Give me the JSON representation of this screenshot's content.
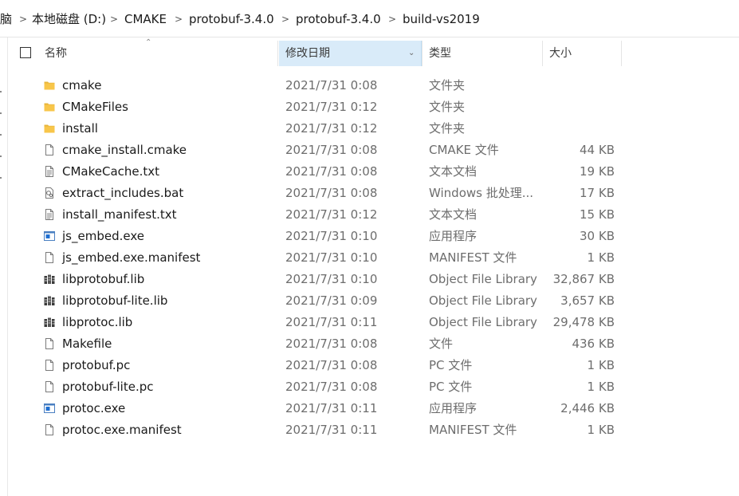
{
  "breadcrumb": [
    {
      "label": "脑"
    },
    {
      "label": "本地磁盘 (D:)"
    },
    {
      "label": "CMAKE"
    },
    {
      "label": "protobuf-3.4.0"
    },
    {
      "label": "protobuf-3.4.0"
    },
    {
      "label": "build-vs2019"
    }
  ],
  "columns": {
    "name": "名称",
    "date": "修改日期",
    "type": "类型",
    "size": "大小",
    "sorted_column": "date"
  },
  "files": [
    {
      "name": "cmake",
      "date": "2021/7/31 0:08",
      "type": "文件夹",
      "size": "",
      "icon": "folder-icon"
    },
    {
      "name": "CMakeFiles",
      "date": "2021/7/31 0:12",
      "type": "文件夹",
      "size": "",
      "icon": "folder-icon"
    },
    {
      "name": "install",
      "date": "2021/7/31 0:12",
      "type": "文件夹",
      "size": "",
      "icon": "folder-icon"
    },
    {
      "name": "cmake_install.cmake",
      "date": "2021/7/31 0:08",
      "type": "CMAKE 文件",
      "size": "44 KB",
      "icon": "file-icon"
    },
    {
      "name": "CMakeCache.txt",
      "date": "2021/7/31 0:08",
      "type": "文本文档",
      "size": "19 KB",
      "icon": "text-file-icon"
    },
    {
      "name": "extract_includes.bat",
      "date": "2021/7/31 0:08",
      "type": "Windows 批处理...",
      "size": "17 KB",
      "icon": "batch-file-icon"
    },
    {
      "name": "install_manifest.txt",
      "date": "2021/7/31 0:12",
      "type": "文本文档",
      "size": "15 KB",
      "icon": "text-file-icon"
    },
    {
      "name": "js_embed.exe",
      "date": "2021/7/31 0:10",
      "type": "应用程序",
      "size": "30 KB",
      "icon": "exe-icon"
    },
    {
      "name": "js_embed.exe.manifest",
      "date": "2021/7/31 0:10",
      "type": "MANIFEST 文件",
      "size": "1 KB",
      "icon": "file-icon"
    },
    {
      "name": "libprotobuf.lib",
      "date": "2021/7/31 0:10",
      "type": "Object File Library",
      "size": "32,867 KB",
      "icon": "library-icon"
    },
    {
      "name": "libprotobuf-lite.lib",
      "date": "2021/7/31 0:09",
      "type": "Object File Library",
      "size": "3,657 KB",
      "icon": "library-icon"
    },
    {
      "name": "libprotoc.lib",
      "date": "2021/7/31 0:11",
      "type": "Object File Library",
      "size": "29,478 KB",
      "icon": "library-icon"
    },
    {
      "name": "Makefile",
      "date": "2021/7/31 0:08",
      "type": "文件",
      "size": "436 KB",
      "icon": "file-icon"
    },
    {
      "name": "protobuf.pc",
      "date": "2021/7/31 0:08",
      "type": "PC 文件",
      "size": "1 KB",
      "icon": "file-icon"
    },
    {
      "name": "protobuf-lite.pc",
      "date": "2021/7/31 0:08",
      "type": "PC 文件",
      "size": "1 KB",
      "icon": "file-icon"
    },
    {
      "name": "protoc.exe",
      "date": "2021/7/31 0:11",
      "type": "应用程序",
      "size": "2,446 KB",
      "icon": "exe-icon"
    },
    {
      "name": "protoc.exe.manifest",
      "date": "2021/7/31 0:11",
      "type": "MANIFEST 文件",
      "size": "1 KB",
      "icon": "file-icon"
    }
  ],
  "colors": {
    "folder": "#f8c64a",
    "header_active_bg": "#d9ebf9",
    "secondary_text": "#6d6d6d",
    "exe_blue": "#1f6fd1"
  }
}
